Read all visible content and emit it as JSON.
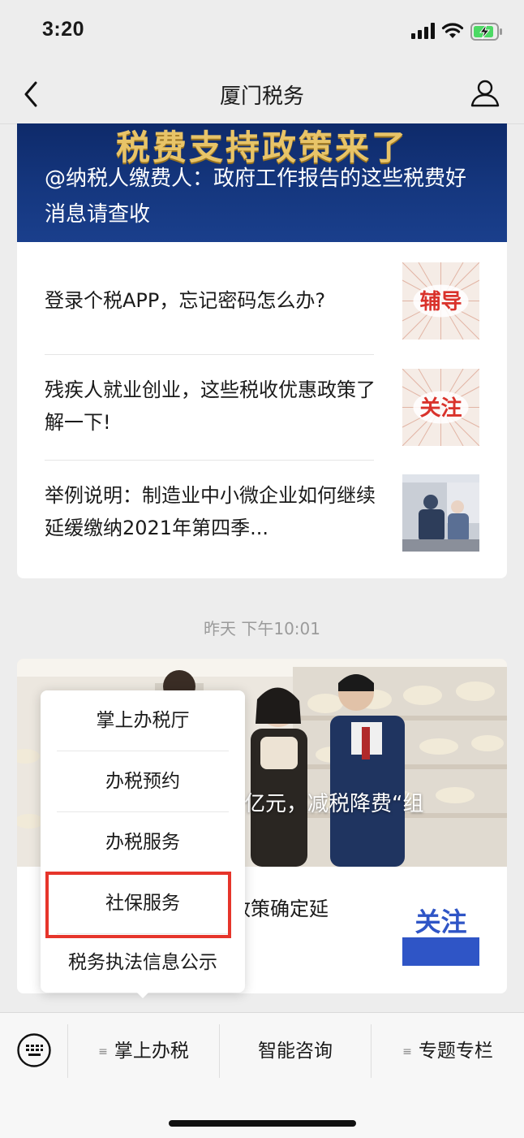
{
  "status_bar": {
    "time": "3:20",
    "icons": [
      "signal-icon",
      "wifi-icon",
      "battery-charging-icon"
    ]
  },
  "nav": {
    "title": "厦门税务",
    "back_icon": "chevron-left-icon",
    "profile_icon": "user-icon"
  },
  "article_group_1": {
    "banner": {
      "image_text": "税费支持政策来了",
      "title": "@纳税人缴费人：政府工作报告的这些税费好消息请查收"
    },
    "items": [
      {
        "title": "登录个税APP，忘记密码怎么办?",
        "thumb_text": "辅导"
      },
      {
        "title": "残疾人就业创业，这些税收优惠政策了解一下!",
        "thumb_text": "关注"
      },
      {
        "title": "举例说明：制造业中小微企业如何继续延缓缴纳2021年第四季..."
      }
    ]
  },
  "timestamp": "昨天 下午10:01",
  "article_group_2": {
    "photo_caption": "亿元，减税降费“组",
    "item_title": "政策确定延",
    "thumb_text": "关注"
  },
  "popup_menu": {
    "items": [
      "掌上办税厅",
      "办税预约",
      "办税服务",
      "社保服务",
      "税务执法信息公示"
    ],
    "highlighted_index": 3
  },
  "bottom_menu": {
    "keyboard_icon": "keyboard-icon",
    "tabs": [
      "掌上办税",
      "智能咨询",
      "专题专栏"
    ]
  },
  "colors": {
    "banner_bg": "#15377f",
    "banner_gold": "#e8c468",
    "highlight": "#e6352b",
    "stamp_red": "#d9322b",
    "focus_blue": "#2f55c6"
  }
}
